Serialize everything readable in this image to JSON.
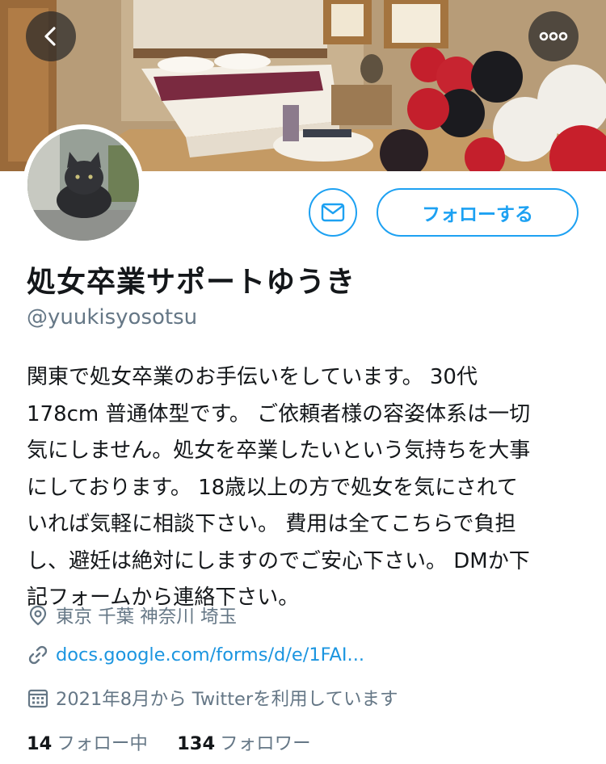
{
  "header": {
    "back_icon": "chevron-left-icon",
    "more_icon": "more-horizontal-icon"
  },
  "profile": {
    "display_name": "処女卒業サポートゆうき",
    "handle": "@yuukisyosotsu",
    "bio_lines": [
      "関東で処女卒業のお手伝いをしています。 30代",
      "178cm 普通体型です。 ご依頼者様の容姿体系は一切",
      "気にしません。処女を卒業したいという気持ちを大事",
      "にしております。 18歳以上の方で処女を気にされて",
      "いれば気軽に相談下さい。 費用は全てこちらで負担",
      "し、避妊は絶対にしますのでご安心下さい。 DMか下",
      "記フォームから連絡下さい。"
    ],
    "location": "東京 千葉 神奈川 埼玉",
    "link": "docs.google.com/forms/d/e/1FAI...",
    "joined": "2021年8月から Twitterを利用しています",
    "following_count": "14",
    "following_label": "フォロー中",
    "followers_count": "134",
    "followers_label": "フォロワー"
  },
  "actions": {
    "follow_label": "フォローする",
    "dm_icon": "mail-icon"
  },
  "colors": {
    "accent": "#1da1f2",
    "link": "#1b95e0",
    "secondary_text": "#657786",
    "primary_text": "#14171a"
  }
}
